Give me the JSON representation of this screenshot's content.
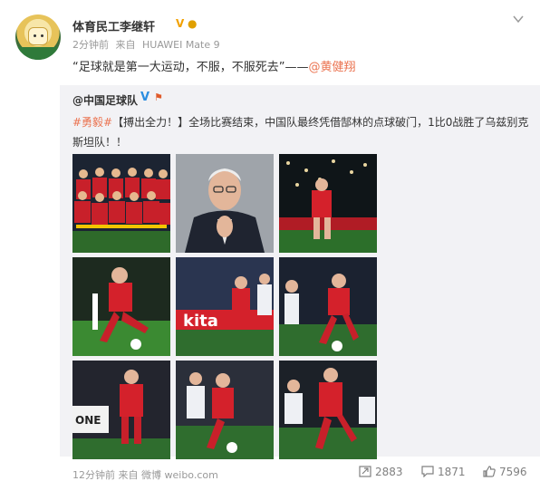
{
  "post": {
    "author": "体育民工李继轩",
    "time": "2分钟前",
    "source_prefix": "来自",
    "source": "HUAWEI Mate 9",
    "text_quote": "“足球就是第一大运动，不服，不服死去”——",
    "text_mention": "@黄健翔"
  },
  "repost": {
    "author": "@中国足球队",
    "hashtag": "#勇毅#",
    "text": "【搏出全力！】全场比赛结束，中国队最终凭借郜林的点球破门，1比0战胜了乌兹别克斯坦队！！",
    "time": "12分钟前",
    "source_prefix": "来自",
    "source": "微博 weibo.com",
    "stats": {
      "reposts": "2883",
      "comments": "1871",
      "likes": "7596"
    }
  },
  "icons": {
    "verified": "verified-v-icon",
    "flag": "bulb-badge-icon",
    "caret": "chevron-down-icon",
    "repost": "repost-icon",
    "comment": "comment-icon",
    "like": "thumbs-up-icon"
  },
  "colors": {
    "link": "#eb7350",
    "verified_blue": "#2a8de0",
    "verified_gold": "#f2a100",
    "repost_bg": "#f2f2f5"
  }
}
